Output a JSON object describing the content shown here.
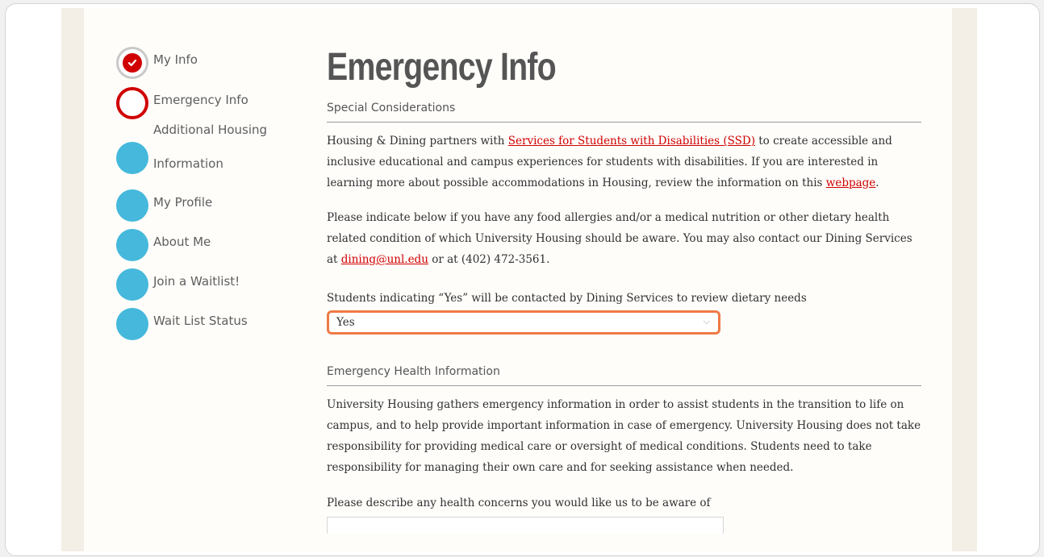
{
  "sidebar": {
    "steps": [
      {
        "label": "My Info",
        "status": "complete"
      },
      {
        "label": "Emergency Info",
        "status": "current"
      },
      {
        "label": "Additional Housing Information",
        "label_line1": "Additional Housing",
        "label_line2": "Information",
        "status": "pending"
      },
      {
        "label": "My Profile",
        "status": "pending"
      },
      {
        "label": "About Me",
        "status": "pending"
      },
      {
        "label": "Join a Waitlist!",
        "status": "pending"
      },
      {
        "label": "Wait List Status",
        "status": "pending"
      }
    ]
  },
  "main": {
    "title": "Emergency Info",
    "special": {
      "heading": "Special Considerations",
      "p1_before": "Housing & Dining partners with ",
      "ssd_link": "Services for Students with Disabilities (SSD)",
      "p1_after": " to create accessible and inclusive educational and campus experiences for students with disabilities. If you are interested in learning more about possible accommodations in Housing, review the information on this ",
      "webpage_link": "webpage",
      "p1_end": ".",
      "p2_before": "Please indicate below if you have any food allergies and/or a medical nutrition or other dietary health related condition of which University Housing should be aware. You may also contact our Dining Services at ",
      "email_link": "dining@unl.edu",
      "p2_after": " or at (402) 472-3561.",
      "dietary_label": "Students indicating “Yes” will be contacted by Dining Services to review dietary needs",
      "dietary_value": "Yes"
    },
    "health": {
      "heading": "Emergency Health Information",
      "body": "University Housing gathers emergency information in order to assist students in the transition to life on campus, and to help provide important information in case of emergency. University Housing does not take responsibility for providing medical care or oversight of medical conditions. Students need to take responsibility for managing their own care and for seeking assistance when needed.",
      "concerns_label": "Please describe any health concerns you would like us to be aware of",
      "concerns_value": ""
    }
  },
  "colors": {
    "accent_red": "#d00000",
    "pending_blue": "#45b8dc",
    "focus_orange": "#ef7a45",
    "cream": "#f3efe6"
  },
  "icons": {
    "complete": "check-icon",
    "select": "chevron-down-icon"
  }
}
